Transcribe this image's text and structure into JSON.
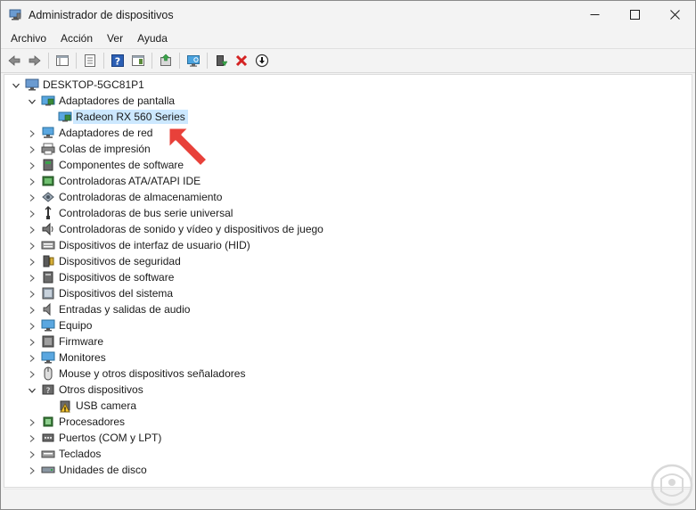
{
  "window": {
    "title": "Administrador de dispositivos"
  },
  "menu": {
    "items": [
      "Archivo",
      "Acción",
      "Ver",
      "Ayuda"
    ]
  },
  "toolbar": {
    "buttons": [
      "back-icon",
      "forward-icon",
      "properties-list-icon",
      "details-icon",
      "help-icon",
      "console-icon",
      "update-driver-icon",
      "scan-hardware-icon",
      "enable-device-icon",
      "uninstall-icon",
      "download-icon"
    ]
  },
  "tree": {
    "root": "DESKTOP-5GC81P1",
    "categories": [
      {
        "label": "Adaptadores de pantalla",
        "expanded": true,
        "children": [
          "Radeon RX 560 Series"
        ]
      },
      {
        "label": "Adaptadores de red"
      },
      {
        "label": "Colas de impresión"
      },
      {
        "label": "Componentes de software"
      },
      {
        "label": "Controladoras ATA/ATAPI IDE"
      },
      {
        "label": "Controladoras de almacenamiento"
      },
      {
        "label": "Controladoras de bus serie universal"
      },
      {
        "label": "Controladoras de sonido y vídeo y dispositivos de juego"
      },
      {
        "label": "Dispositivos de interfaz de usuario (HID)"
      },
      {
        "label": "Dispositivos de seguridad"
      },
      {
        "label": "Dispositivos de software"
      },
      {
        "label": "Dispositivos del sistema"
      },
      {
        "label": "Entradas y salidas de audio"
      },
      {
        "label": "Equipo"
      },
      {
        "label": "Firmware"
      },
      {
        "label": "Monitores"
      },
      {
        "label": "Mouse y otros dispositivos señaladores"
      },
      {
        "label": "Otros dispositivos",
        "expanded": true,
        "children": [
          "USB camera"
        ]
      },
      {
        "label": "Procesadores"
      },
      {
        "label": "Puertos (COM y LPT)"
      },
      {
        "label": "Teclados"
      },
      {
        "label": "Unidades de disco"
      }
    ]
  },
  "colors": {
    "selection": "#cce8ff",
    "annotation": "#e8413a"
  }
}
